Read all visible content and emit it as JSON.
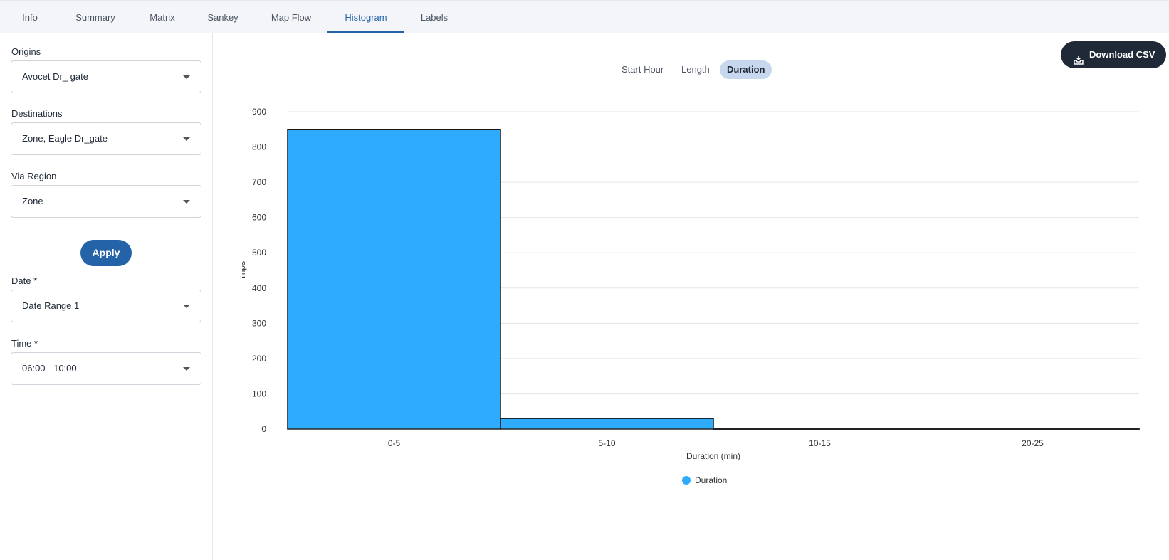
{
  "tabs": [
    {
      "label": "Info",
      "active": false
    },
    {
      "label": "Summary",
      "active": false
    },
    {
      "label": "Matrix",
      "active": false
    },
    {
      "label": "Sankey",
      "active": false
    },
    {
      "label": "Map Flow",
      "active": false
    },
    {
      "label": "Histogram",
      "active": true
    },
    {
      "label": "Labels",
      "active": false
    }
  ],
  "sidebar": {
    "origins": {
      "label": "Origins",
      "value": "Avocet Dr_ gate"
    },
    "destinations": {
      "label": "Destinations",
      "value": "Zone, Eagle Dr_gate"
    },
    "via_region": {
      "label": "Via Region",
      "value": "Zone"
    },
    "apply_label": "Apply",
    "date": {
      "label": "Date *",
      "value": "Date Range 1"
    },
    "time": {
      "label": "Time *",
      "value": "06:00 - 10:00"
    }
  },
  "toolbar": {
    "download_label": "Download CSV",
    "download_icon": "inbox-download-icon"
  },
  "histogram_modes": [
    {
      "label": "Start Hour",
      "active": false
    },
    {
      "label": "Length",
      "active": false
    },
    {
      "label": "Duration",
      "active": true
    }
  ],
  "colors": {
    "accent": "#2563a8",
    "bar_fill": "#2eabfc",
    "dark_button": "#1f2937",
    "active_segment": "#c7d7ee"
  },
  "chart_data": {
    "type": "bar",
    "categories": [
      "0-5",
      "5-10",
      "10-15",
      "20-25"
    ],
    "series": [
      {
        "name": "Duration",
        "values": [
          850,
          30,
          1,
          1
        ]
      }
    ],
    "xlabel": "Duration (min)",
    "ylabel": "Trips",
    "ylim": [
      0,
      900
    ],
    "yticks": [
      0,
      100,
      200,
      300,
      400,
      500,
      600,
      700,
      800,
      900
    ],
    "grid": true,
    "legend": "bottom-center"
  }
}
